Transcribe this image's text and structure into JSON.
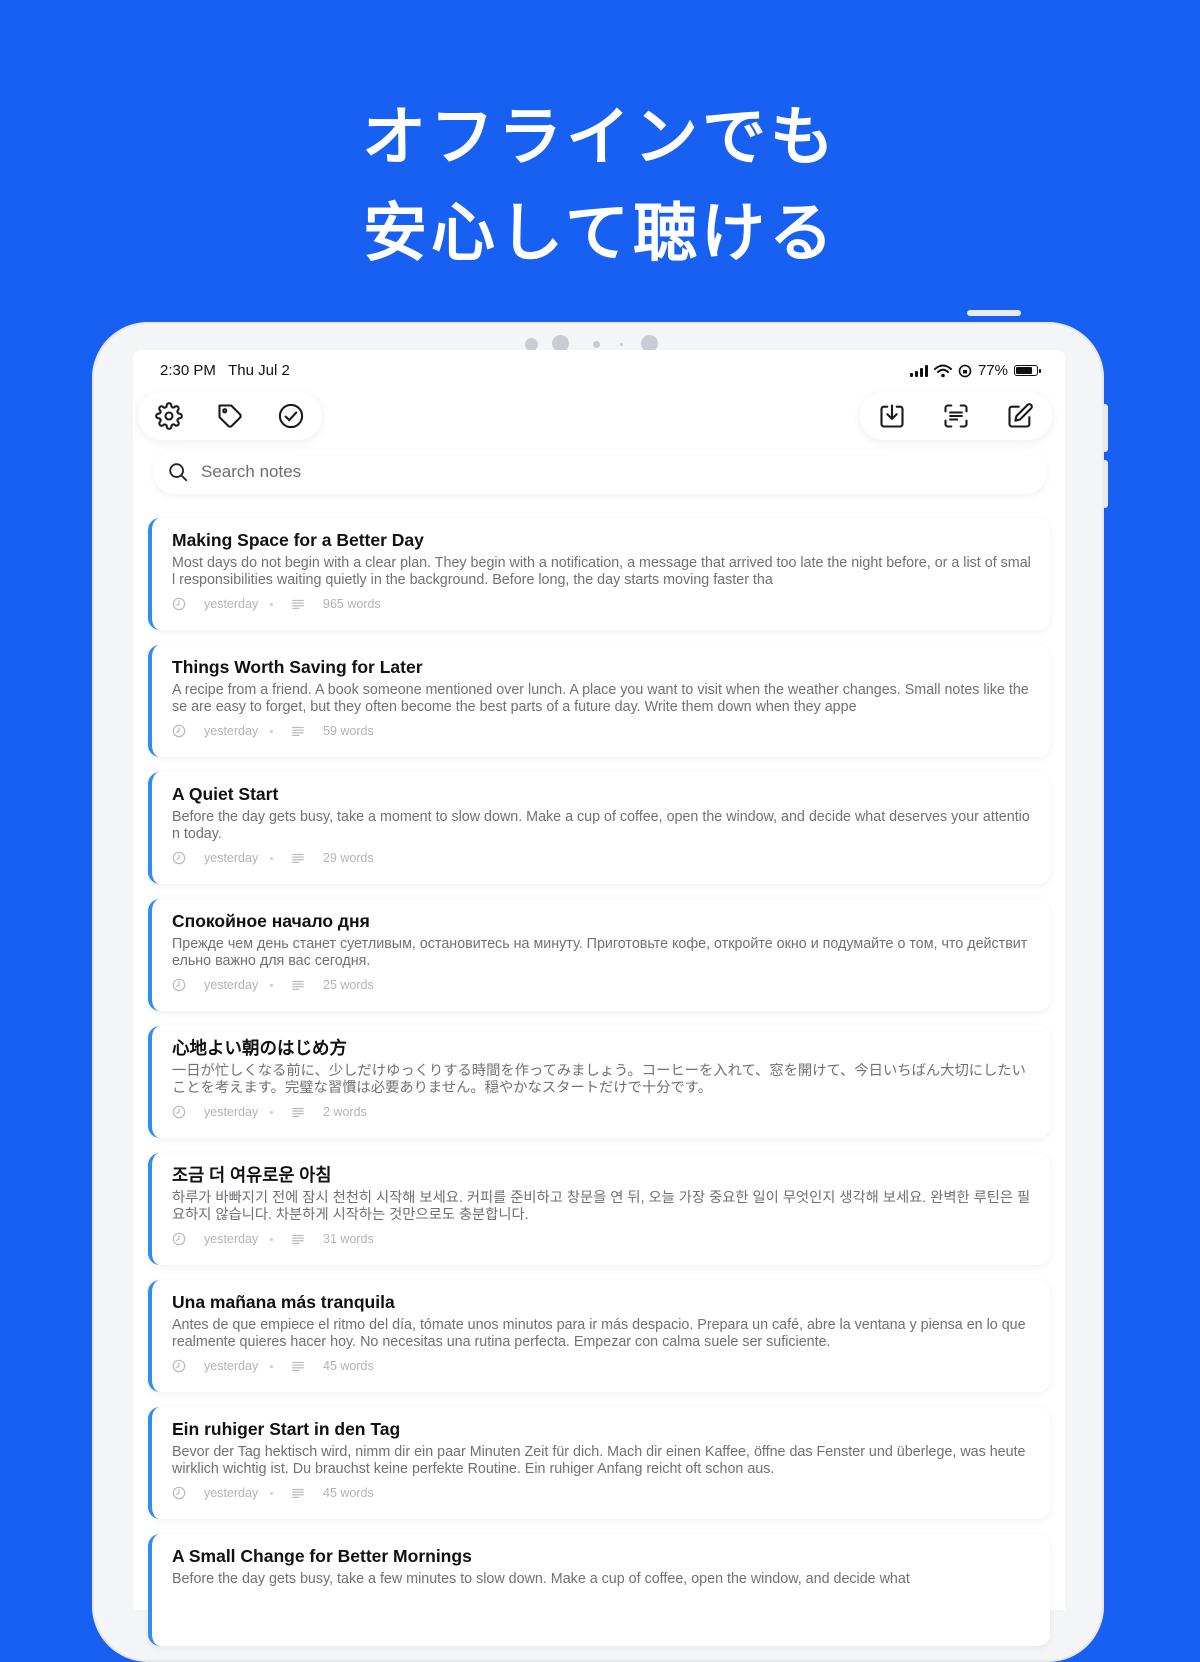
{
  "headline": {
    "line1": "オフラインでも",
    "line2": "安心して聴ける"
  },
  "status_bar": {
    "time": "2:30 PM",
    "date": "Thu Jul 2",
    "battery": "77%"
  },
  "toolbar": {
    "left": [
      "settings-icon",
      "tag-icon",
      "checkmark-circle-icon"
    ],
    "right": [
      "download-icon",
      "scan-text-icon",
      "compose-icon"
    ]
  },
  "search": {
    "placeholder": "Search notes"
  },
  "notes": [
    {
      "title": "Making Space for a Better Day",
      "preview": "Most days do not begin with a clear plan. They begin with a notification, a message that arrived too late the night before, or a list of small responsibilities waiting quietly in the background. Before long, the day starts moving faster tha",
      "date": "yesterday",
      "words": "965 words"
    },
    {
      "title": "Things Worth Saving for Later",
      "preview": "A recipe from a friend. A book someone mentioned over lunch. A place you want to visit when the weather changes. Small notes like these are easy to forget, but they often become the best parts of a future day. Write them down when they appe",
      "date": "yesterday",
      "words": "59 words"
    },
    {
      "title": "A Quiet Start",
      "preview": "Before the day gets busy, take a moment to slow down. Make a cup of coffee, open the window, and decide what deserves your attention today.",
      "date": "yesterday",
      "words": "29 words"
    },
    {
      "title": "Спокойное начало дня",
      "preview": "Прежде чем день станет суетливым, остановитесь на минуту. Приготовьте кофе, откройте окно и подумайте о том, что действительно важно для вас сегодня.",
      "date": "yesterday",
      "words": "25 words"
    },
    {
      "title": "心地よい朝のはじめ方",
      "preview": "一日が忙しくなる前に、少しだけゆっくりする時間を作ってみましょう。コーヒーを入れて、窓を開けて、今日いちばん大切にしたいことを考えます。完璧な習慣は必要ありません。穏やかなスタートだけで十分です。",
      "date": "yesterday",
      "words": "2 words"
    },
    {
      "title": "조금 더 여유로운 아침",
      "preview": "하루가 바빠지기 전에 잠시 천천히 시작해 보세요. 커피를 준비하고 창문을 연 뒤, 오늘 가장 중요한 일이 무엇인지 생각해 보세요. 완벽한 루틴은 필요하지 않습니다. 차분하게 시작하는 것만으로도 충분합니다.",
      "date": "yesterday",
      "words": "31 words"
    },
    {
      "title": "Una mañana más tranquila",
      "preview": "Antes de que empiece el ritmo del día, tómate unos minutos para ir más despacio. Prepara un café, abre la ventana y piensa en lo que realmente quieres hacer hoy. No necesitas una rutina perfecta. Empezar con calma suele ser suficiente.",
      "date": "yesterday",
      "words": "45 words"
    },
    {
      "title": "Ein ruhiger Start in den Tag",
      "preview": "Bevor der Tag hektisch wird, nimm dir ein paar Minuten Zeit für dich. Mach dir einen Kaffee, öffne das Fenster und überlege, was heute wirklich wichtig ist. Du brauchst keine perfekte Routine. Ein ruhiger Anfang reicht oft schon aus.",
      "date": "yesterday",
      "words": "45 words"
    },
    {
      "title": "A Small Change for Better Mornings",
      "preview": "Before the day gets busy, take a few minutes to slow down. Make a cup of coffee, open the window, and decide what",
      "date": "",
      "words": ""
    }
  ],
  "colors": {
    "background": "#1760F1",
    "accent": "#2F8CF0"
  }
}
